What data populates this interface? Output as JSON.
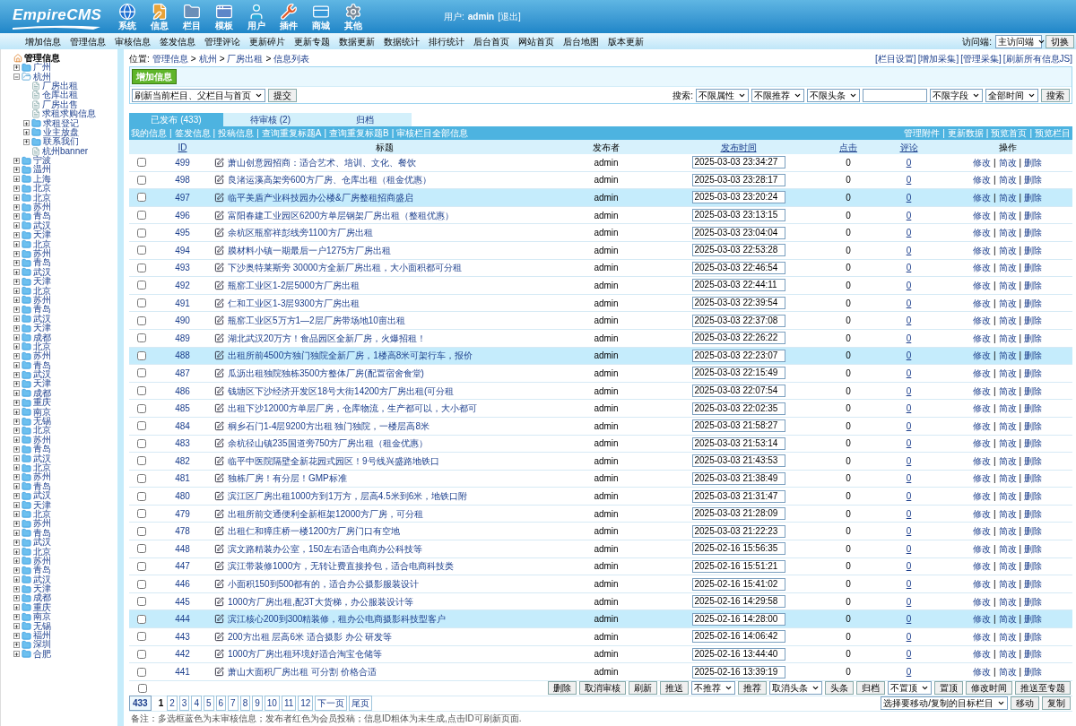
{
  "header": {
    "logo": "EmpireCMS",
    "nav": [
      "系统",
      "信息",
      "栏目",
      "模板",
      "用户",
      "插件",
      "商城",
      "其他"
    ],
    "user_label": "用户:",
    "user": "admin",
    "logout": "[退出]"
  },
  "menu": {
    "items": [
      "增加信息",
      "管理信息",
      "审核信息",
      "签发信息",
      "管理评论",
      "更新碎片",
      "更新专题",
      "数据更新",
      "数据统计",
      "排行统计",
      "后台首页",
      "网站首页",
      "后台地图",
      "版本更新"
    ],
    "access_label": "访问端:",
    "access_value": "主访问端",
    "switch_button": "切换"
  },
  "sidebar": {
    "root": "管理信息",
    "tree": [
      {
        "label": "广州",
        "kind": "folder",
        "expanded": false
      },
      {
        "label": "杭州",
        "kind": "folder",
        "expanded": true,
        "children": [
          {
            "label": "厂房出租",
            "kind": "page"
          },
          {
            "label": "仓库出租",
            "kind": "page"
          },
          {
            "label": "厂房出售",
            "kind": "page"
          },
          {
            "label": "求租求购信息",
            "kind": "page"
          },
          {
            "label": "求租登记",
            "kind": "folder",
            "expanded": false
          },
          {
            "label": "业主放盘",
            "kind": "folder",
            "expanded": false
          },
          {
            "label": "联系我们",
            "kind": "folder",
            "expanded": false
          },
          {
            "label": "杭州banner",
            "kind": "page"
          }
        ]
      },
      {
        "label": "宁波",
        "kind": "folder",
        "expanded": false
      },
      {
        "label": "温州",
        "kind": "folder",
        "expanded": false
      },
      {
        "label": "上海",
        "kind": "folder",
        "expanded": false
      },
      {
        "label": "北京",
        "kind": "folder",
        "expanded": false
      },
      {
        "label": "北京",
        "kind": "folder",
        "expanded": false
      },
      {
        "label": "苏州",
        "kind": "folder",
        "expanded": false
      },
      {
        "label": "青岛",
        "kind": "folder",
        "expanded": false
      },
      {
        "label": "武汉",
        "kind": "folder",
        "expanded": false
      },
      {
        "label": "天津",
        "kind": "folder",
        "expanded": false
      },
      {
        "label": "北京",
        "kind": "folder",
        "expanded": false
      },
      {
        "label": "苏州",
        "kind": "folder",
        "expanded": false
      },
      {
        "label": "青岛",
        "kind": "folder",
        "expanded": false
      },
      {
        "label": "武汉",
        "kind": "folder",
        "expanded": false
      },
      {
        "label": "天津",
        "kind": "folder",
        "expanded": false
      },
      {
        "label": "北京",
        "kind": "folder",
        "expanded": false
      },
      {
        "label": "苏州",
        "kind": "folder",
        "expanded": false
      },
      {
        "label": "青岛",
        "kind": "folder",
        "expanded": false
      },
      {
        "label": "武汉",
        "kind": "folder",
        "expanded": false
      },
      {
        "label": "天津",
        "kind": "folder",
        "expanded": false
      },
      {
        "label": "成都",
        "kind": "folder",
        "expanded": false
      },
      {
        "label": "北京",
        "kind": "folder",
        "expanded": false
      },
      {
        "label": "苏州",
        "kind": "folder",
        "expanded": false
      },
      {
        "label": "青岛",
        "kind": "folder",
        "expanded": false
      },
      {
        "label": "武汉",
        "kind": "folder",
        "expanded": false
      },
      {
        "label": "天津",
        "kind": "folder",
        "expanded": false
      },
      {
        "label": "成都",
        "kind": "folder",
        "expanded": false
      },
      {
        "label": "重庆",
        "kind": "folder",
        "expanded": false
      },
      {
        "label": "南京",
        "kind": "folder",
        "expanded": false
      },
      {
        "label": "无锡",
        "kind": "folder",
        "expanded": false
      },
      {
        "label": "北京",
        "kind": "folder",
        "expanded": false
      },
      {
        "label": "苏州",
        "kind": "folder",
        "expanded": false
      },
      {
        "label": "青岛",
        "kind": "folder",
        "expanded": false
      },
      {
        "label": "武汉",
        "kind": "folder",
        "expanded": false
      },
      {
        "label": "北京",
        "kind": "folder",
        "expanded": false
      },
      {
        "label": "苏州",
        "kind": "folder",
        "expanded": false
      },
      {
        "label": "青岛",
        "kind": "folder",
        "expanded": false
      },
      {
        "label": "武汉",
        "kind": "folder",
        "expanded": false
      },
      {
        "label": "天津",
        "kind": "folder",
        "expanded": false
      },
      {
        "label": "北京",
        "kind": "folder",
        "expanded": false
      },
      {
        "label": "苏州",
        "kind": "folder",
        "expanded": false
      },
      {
        "label": "青岛",
        "kind": "folder",
        "expanded": false
      },
      {
        "label": "武汉",
        "kind": "folder",
        "expanded": false
      },
      {
        "label": "北京",
        "kind": "folder",
        "expanded": false
      },
      {
        "label": "苏州",
        "kind": "folder",
        "expanded": false
      },
      {
        "label": "青岛",
        "kind": "folder",
        "expanded": false
      },
      {
        "label": "武汉",
        "kind": "folder",
        "expanded": false
      },
      {
        "label": "天津",
        "kind": "folder",
        "expanded": false
      },
      {
        "label": "成都",
        "kind": "folder",
        "expanded": false
      },
      {
        "label": "重庆",
        "kind": "folder",
        "expanded": false
      },
      {
        "label": "南京",
        "kind": "folder",
        "expanded": false
      },
      {
        "label": "无锡",
        "kind": "folder",
        "expanded": false
      },
      {
        "label": "福州",
        "kind": "folder",
        "expanded": false
      },
      {
        "label": "深圳",
        "kind": "folder",
        "expanded": false
      },
      {
        "label": "合肥",
        "kind": "folder",
        "expanded": false
      }
    ]
  },
  "breadcrumb": {
    "label": "位置:",
    "items": [
      "管理信息",
      "杭州",
      "厂房出租",
      "信息列表"
    ],
    "separator": ">",
    "links": [
      "[栏目设置]",
      "[增加采集]",
      "[管理采集]",
      "[刷新所有信息JS]"
    ]
  },
  "toolbar": {
    "add_button": "增加信息",
    "refresh_select": "刷新当前栏目、父栏目与首页",
    "submit_button": "提交",
    "search_label": "搜索:",
    "search_selects": [
      "不限属性",
      "不限推荐",
      "不限头条"
    ],
    "field_select": "不限字段",
    "time_select": "全部时间",
    "search_button": "搜索"
  },
  "tabs": [
    {
      "label": "已发布 (433)",
      "selected": true
    },
    {
      "label": "待审核 (2)",
      "selected": false
    },
    {
      "label": "归档",
      "selected": false
    }
  ],
  "links_bar": {
    "separator": "|",
    "left": [
      "我的信息",
      "签发信息",
      "投稿信息",
      "查询重复标题A",
      "查询重复标题B",
      "审核栏目全部信息"
    ],
    "right": [
      "管理附件",
      "更新数据",
      "预览首页",
      "预览栏目"
    ]
  },
  "table": {
    "action_separator": "|",
    "columns": [
      "ID",
      "标题",
      "发布者",
      "发布时间",
      "点击",
      "评论",
      "操作"
    ],
    "rows": [
      {
        "id": "499",
        "title": "萧山创意园招商：适合艺术、培训、文化、餐饮",
        "publisher": "admin",
        "time": "2025-03-03 23:34:27",
        "clicks": "0",
        "comments": "0",
        "actions": [
          "修改",
          "简改",
          "删除"
        ],
        "highlighted": false,
        "checked": false
      },
      {
        "id": "498",
        "title": "良渚运溪高架旁600方厂房、仓库出租（租金优惠）",
        "publisher": "admin",
        "time": "2025-03-03 23:28:17",
        "clicks": "0",
        "comments": "0",
        "actions": [
          "修改",
          "简改",
          "删除"
        ],
        "highlighted": false,
        "checked": false
      },
      {
        "id": "497",
        "title": "临平美盾产业科技园办公楼&厂房整租招商盛启",
        "publisher": "admin",
        "time": "2025-03-03 23:20:24",
        "clicks": "0",
        "comments": "0",
        "actions": [
          "修改",
          "简改",
          "删除"
        ],
        "highlighted": true,
        "checked": false
      },
      {
        "id": "496",
        "title": "富阳春建工业园区6200方单层钢架厂房出租（整租优惠）",
        "publisher": "admin",
        "time": "2025-03-03 23:13:15",
        "clicks": "0",
        "comments": "0",
        "actions": [
          "修改",
          "简改",
          "删除"
        ],
        "highlighted": false,
        "checked": false
      },
      {
        "id": "495",
        "title": "余杭区瓶窑祥彭线旁1100方厂房出租",
        "publisher": "admin",
        "time": "2025-03-03 23:04:04",
        "clicks": "0",
        "comments": "0",
        "actions": [
          "修改",
          "简改",
          "删除"
        ],
        "highlighted": false,
        "checked": false
      },
      {
        "id": "494",
        "title": "膜材料小镇一期最后一户1275方厂房出租",
        "publisher": "admin",
        "time": "2025-03-03 22:53:28",
        "clicks": "0",
        "comments": "0",
        "actions": [
          "修改",
          "简改",
          "删除"
        ],
        "highlighted": false,
        "checked": false
      },
      {
        "id": "493",
        "title": "下沙奥特莱斯旁 30000方全新厂房出租，大小面积都可分租",
        "publisher": "admin",
        "time": "2025-03-03 22:46:54",
        "clicks": "0",
        "comments": "0",
        "actions": [
          "修改",
          "简改",
          "删除"
        ],
        "highlighted": false,
        "checked": false
      },
      {
        "id": "492",
        "title": "瓶窑工业区1-2层5000方厂房出租",
        "publisher": "admin",
        "time": "2025-03-03 22:44:11",
        "clicks": "0",
        "comments": "0",
        "actions": [
          "修改",
          "简改",
          "删除"
        ],
        "highlighted": false,
        "checked": false
      },
      {
        "id": "491",
        "title": "仁和工业区1-3层9300方厂房出租",
        "publisher": "admin",
        "time": "2025-03-03 22:39:54",
        "clicks": "0",
        "comments": "0",
        "actions": [
          "修改",
          "简改",
          "删除"
        ],
        "highlighted": false,
        "checked": false
      },
      {
        "id": "490",
        "title": "瓶窑工业区5万方1—2层厂房带场地10亩出租",
        "publisher": "admin",
        "time": "2025-03-03 22:37:08",
        "clicks": "0",
        "comments": "0",
        "actions": [
          "修改",
          "简改",
          "删除"
        ],
        "highlighted": false,
        "checked": false
      },
      {
        "id": "489",
        "title": "湖北武汉20万方！食品园区全新厂房，火爆招租！",
        "publisher": "admin",
        "time": "2025-03-03 22:26:22",
        "clicks": "0",
        "comments": "0",
        "actions": [
          "修改",
          "简改",
          "删除"
        ],
        "highlighted": false,
        "checked": false
      },
      {
        "id": "488",
        "title": "出租所前4500方独门独院全新厂房，1楼高8米可架行车，报价",
        "publisher": "admin",
        "time": "2025-03-03 22:23:07",
        "clicks": "0",
        "comments": "0",
        "actions": [
          "修改",
          "简改",
          "删除"
        ],
        "highlighted": true,
        "checked": false
      },
      {
        "id": "487",
        "title": "瓜沥出租独院独栋3500方整体厂房(配置宿舍食堂)",
        "publisher": "admin",
        "time": "2025-03-03 22:15:49",
        "clicks": "0",
        "comments": "0",
        "actions": [
          "修改",
          "简改",
          "删除"
        ],
        "highlighted": false,
        "checked": false
      },
      {
        "id": "486",
        "title": "钱塘区下沙经济开发区18号大街14200方厂房出租(可分租",
        "publisher": "admin",
        "time": "2025-03-03 22:07:54",
        "clicks": "0",
        "comments": "0",
        "actions": [
          "修改",
          "简改",
          "删除"
        ],
        "highlighted": false,
        "checked": false
      },
      {
        "id": "485",
        "title": "出租下沙12000方单层厂房，仓库物流，生产都可以，大小都可",
        "publisher": "admin",
        "time": "2025-03-03 22:02:35",
        "clicks": "0",
        "comments": "0",
        "actions": [
          "修改",
          "简改",
          "删除"
        ],
        "highlighted": false,
        "checked": false
      },
      {
        "id": "484",
        "title": "桐乡石门1-4层9200方出租 独门独院，一楼层高8米",
        "publisher": "admin",
        "time": "2025-03-03 21:58:27",
        "clicks": "0",
        "comments": "0",
        "actions": [
          "修改",
          "简改",
          "删除"
        ],
        "highlighted": false,
        "checked": false
      },
      {
        "id": "483",
        "title": "余杭径山镇235国道旁750方厂房出租（租金优惠）",
        "publisher": "admin",
        "time": "2025-03-03 21:53:14",
        "clicks": "0",
        "comments": "0",
        "actions": [
          "修改",
          "简改",
          "删除"
        ],
        "highlighted": false,
        "checked": false
      },
      {
        "id": "482",
        "title": "临平中医院隔壁全新花园式园区！9号线兴盛路地铁口",
        "publisher": "admin",
        "time": "2025-03-03 21:43:53",
        "clicks": "0",
        "comments": "0",
        "actions": [
          "修改",
          "简改",
          "删除"
        ],
        "highlighted": false,
        "checked": false
      },
      {
        "id": "481",
        "title": "独栋厂房！有分层！GMP标准",
        "publisher": "admin",
        "time": "2025-03-03 21:38:49",
        "clicks": "0",
        "comments": "0",
        "actions": [
          "修改",
          "简改",
          "删除"
        ],
        "highlighted": false,
        "checked": false
      },
      {
        "id": "480",
        "title": "滨江区厂房出租1000方到1万方，层高4.5米到6米，地铁口附",
        "publisher": "admin",
        "time": "2025-03-03 21:31:47",
        "clicks": "0",
        "comments": "0",
        "actions": [
          "修改",
          "简改",
          "删除"
        ],
        "highlighted": false,
        "checked": false
      },
      {
        "id": "479",
        "title": "出租所前交通便利全新框架12000方厂房，可分租",
        "publisher": "admin",
        "time": "2025-03-03 21:28:09",
        "clicks": "0",
        "comments": "0",
        "actions": [
          "修改",
          "简改",
          "删除"
        ],
        "highlighted": false,
        "checked": false
      },
      {
        "id": "478",
        "title": "出租仁和獐庄桥一楼1200方厂房门口有空地",
        "publisher": "admin",
        "time": "2025-03-03 21:22:23",
        "clicks": "0",
        "comments": "0",
        "actions": [
          "修改",
          "简改",
          "删除"
        ],
        "highlighted": false,
        "checked": false
      },
      {
        "id": "448",
        "title": "滨文路精装办公室，150左右适合电商办公科技等",
        "publisher": "admin",
        "time": "2025-02-16 15:56:35",
        "clicks": "0",
        "comments": "0",
        "actions": [
          "修改",
          "简改",
          "删除"
        ],
        "highlighted": false,
        "checked": false
      },
      {
        "id": "447",
        "title": "滨江带装修1000方，无转让费直接拎包，适合电商科技类",
        "publisher": "admin",
        "time": "2025-02-16 15:51:21",
        "clicks": "0",
        "comments": "0",
        "actions": [
          "修改",
          "简改",
          "删除"
        ],
        "highlighted": false,
        "checked": false
      },
      {
        "id": "446",
        "title": "小面积150到500都有的，适合办公摄影服装设计",
        "publisher": "admin",
        "time": "2025-02-16 15:41:02",
        "clicks": "0",
        "comments": "0",
        "actions": [
          "修改",
          "简改",
          "删除"
        ],
        "highlighted": false,
        "checked": false
      },
      {
        "id": "445",
        "title": "1000方厂房出租,配3T大货梯，办公服装设计等",
        "publisher": "admin",
        "time": "2025-02-16 14:29:58",
        "clicks": "0",
        "comments": "0",
        "actions": [
          "修改",
          "简改",
          "删除"
        ],
        "highlighted": false,
        "checked": false
      },
      {
        "id": "444",
        "title": "滨江核心200到300精装修，租办公电商摄影科技型客户",
        "publisher": "admin",
        "time": "2025-02-16 14:28:00",
        "clicks": "0",
        "comments": "0",
        "actions": [
          "修改",
          "简改",
          "删除"
        ],
        "highlighted": true,
        "checked": false
      },
      {
        "id": "443",
        "title": "200方出租 层高6米 适合摄影 办公 研发等",
        "publisher": "admin",
        "time": "2025-02-16 14:06:42",
        "clicks": "0",
        "comments": "0",
        "actions": [
          "修改",
          "简改",
          "删除"
        ],
        "highlighted": false,
        "checked": false
      },
      {
        "id": "442",
        "title": "1000方厂房出租环境好适合淘宝仓储等",
        "publisher": "admin",
        "time": "2025-02-16 13:44:40",
        "clicks": "0",
        "comments": "0",
        "actions": [
          "修改",
          "简改",
          "删除"
        ],
        "highlighted": false,
        "checked": false
      },
      {
        "id": "441",
        "title": "萧山大面积厂房出租 可分割 价格合适",
        "publisher": "admin",
        "time": "2025-02-16 13:39:19",
        "clicks": "0",
        "comments": "0",
        "actions": [
          "修改",
          "简改",
          "删除"
        ],
        "highlighted": false,
        "checked": false
      }
    ]
  },
  "bulk_actions": {
    "select_all_checked": false,
    "controls": [
      {
        "kind": "button",
        "label": "删除"
      },
      {
        "kind": "button",
        "label": "取消审核"
      },
      {
        "kind": "button",
        "label": "刷新"
      },
      {
        "kind": "button",
        "label": "推送"
      },
      {
        "kind": "select",
        "label": "不推荐"
      },
      {
        "kind": "button",
        "label": "推荐"
      },
      {
        "kind": "select",
        "label": "取消头条"
      },
      {
        "kind": "button",
        "label": "头条"
      },
      {
        "kind": "button",
        "label": "归档"
      },
      {
        "kind": "select",
        "label": "不置顶"
      },
      {
        "kind": "button",
        "label": "置顶"
      },
      {
        "kind": "button",
        "label": "修改时间"
      },
      {
        "kind": "button",
        "label": "推送至专题"
      }
    ]
  },
  "pagination": {
    "total": "433",
    "pages": [
      {
        "label": "1",
        "selected": true
      },
      {
        "label": "2",
        "selected": false
      },
      {
        "label": "3",
        "selected": false
      },
      {
        "label": "4",
        "selected": false
      },
      {
        "label": "5",
        "selected": false
      },
      {
        "label": "6",
        "selected": false
      },
      {
        "label": "7",
        "selected": false
      },
      {
        "label": "8",
        "selected": false
      },
      {
        "label": "9",
        "selected": false
      },
      {
        "label": "10",
        "selected": false
      },
      {
        "label": "11",
        "selected": false
      },
      {
        "label": "12",
        "selected": false
      }
    ],
    "next": "下一页",
    "last": "尾页",
    "target_select": "选择要移动/复制的目标栏目",
    "move_button": "移动",
    "copy_button": "复制"
  },
  "note": "备注：多选框蓝色为未审核信息；发布者红色为会员投稿；信息ID粗体为未生成,点击ID可刷新页面."
}
